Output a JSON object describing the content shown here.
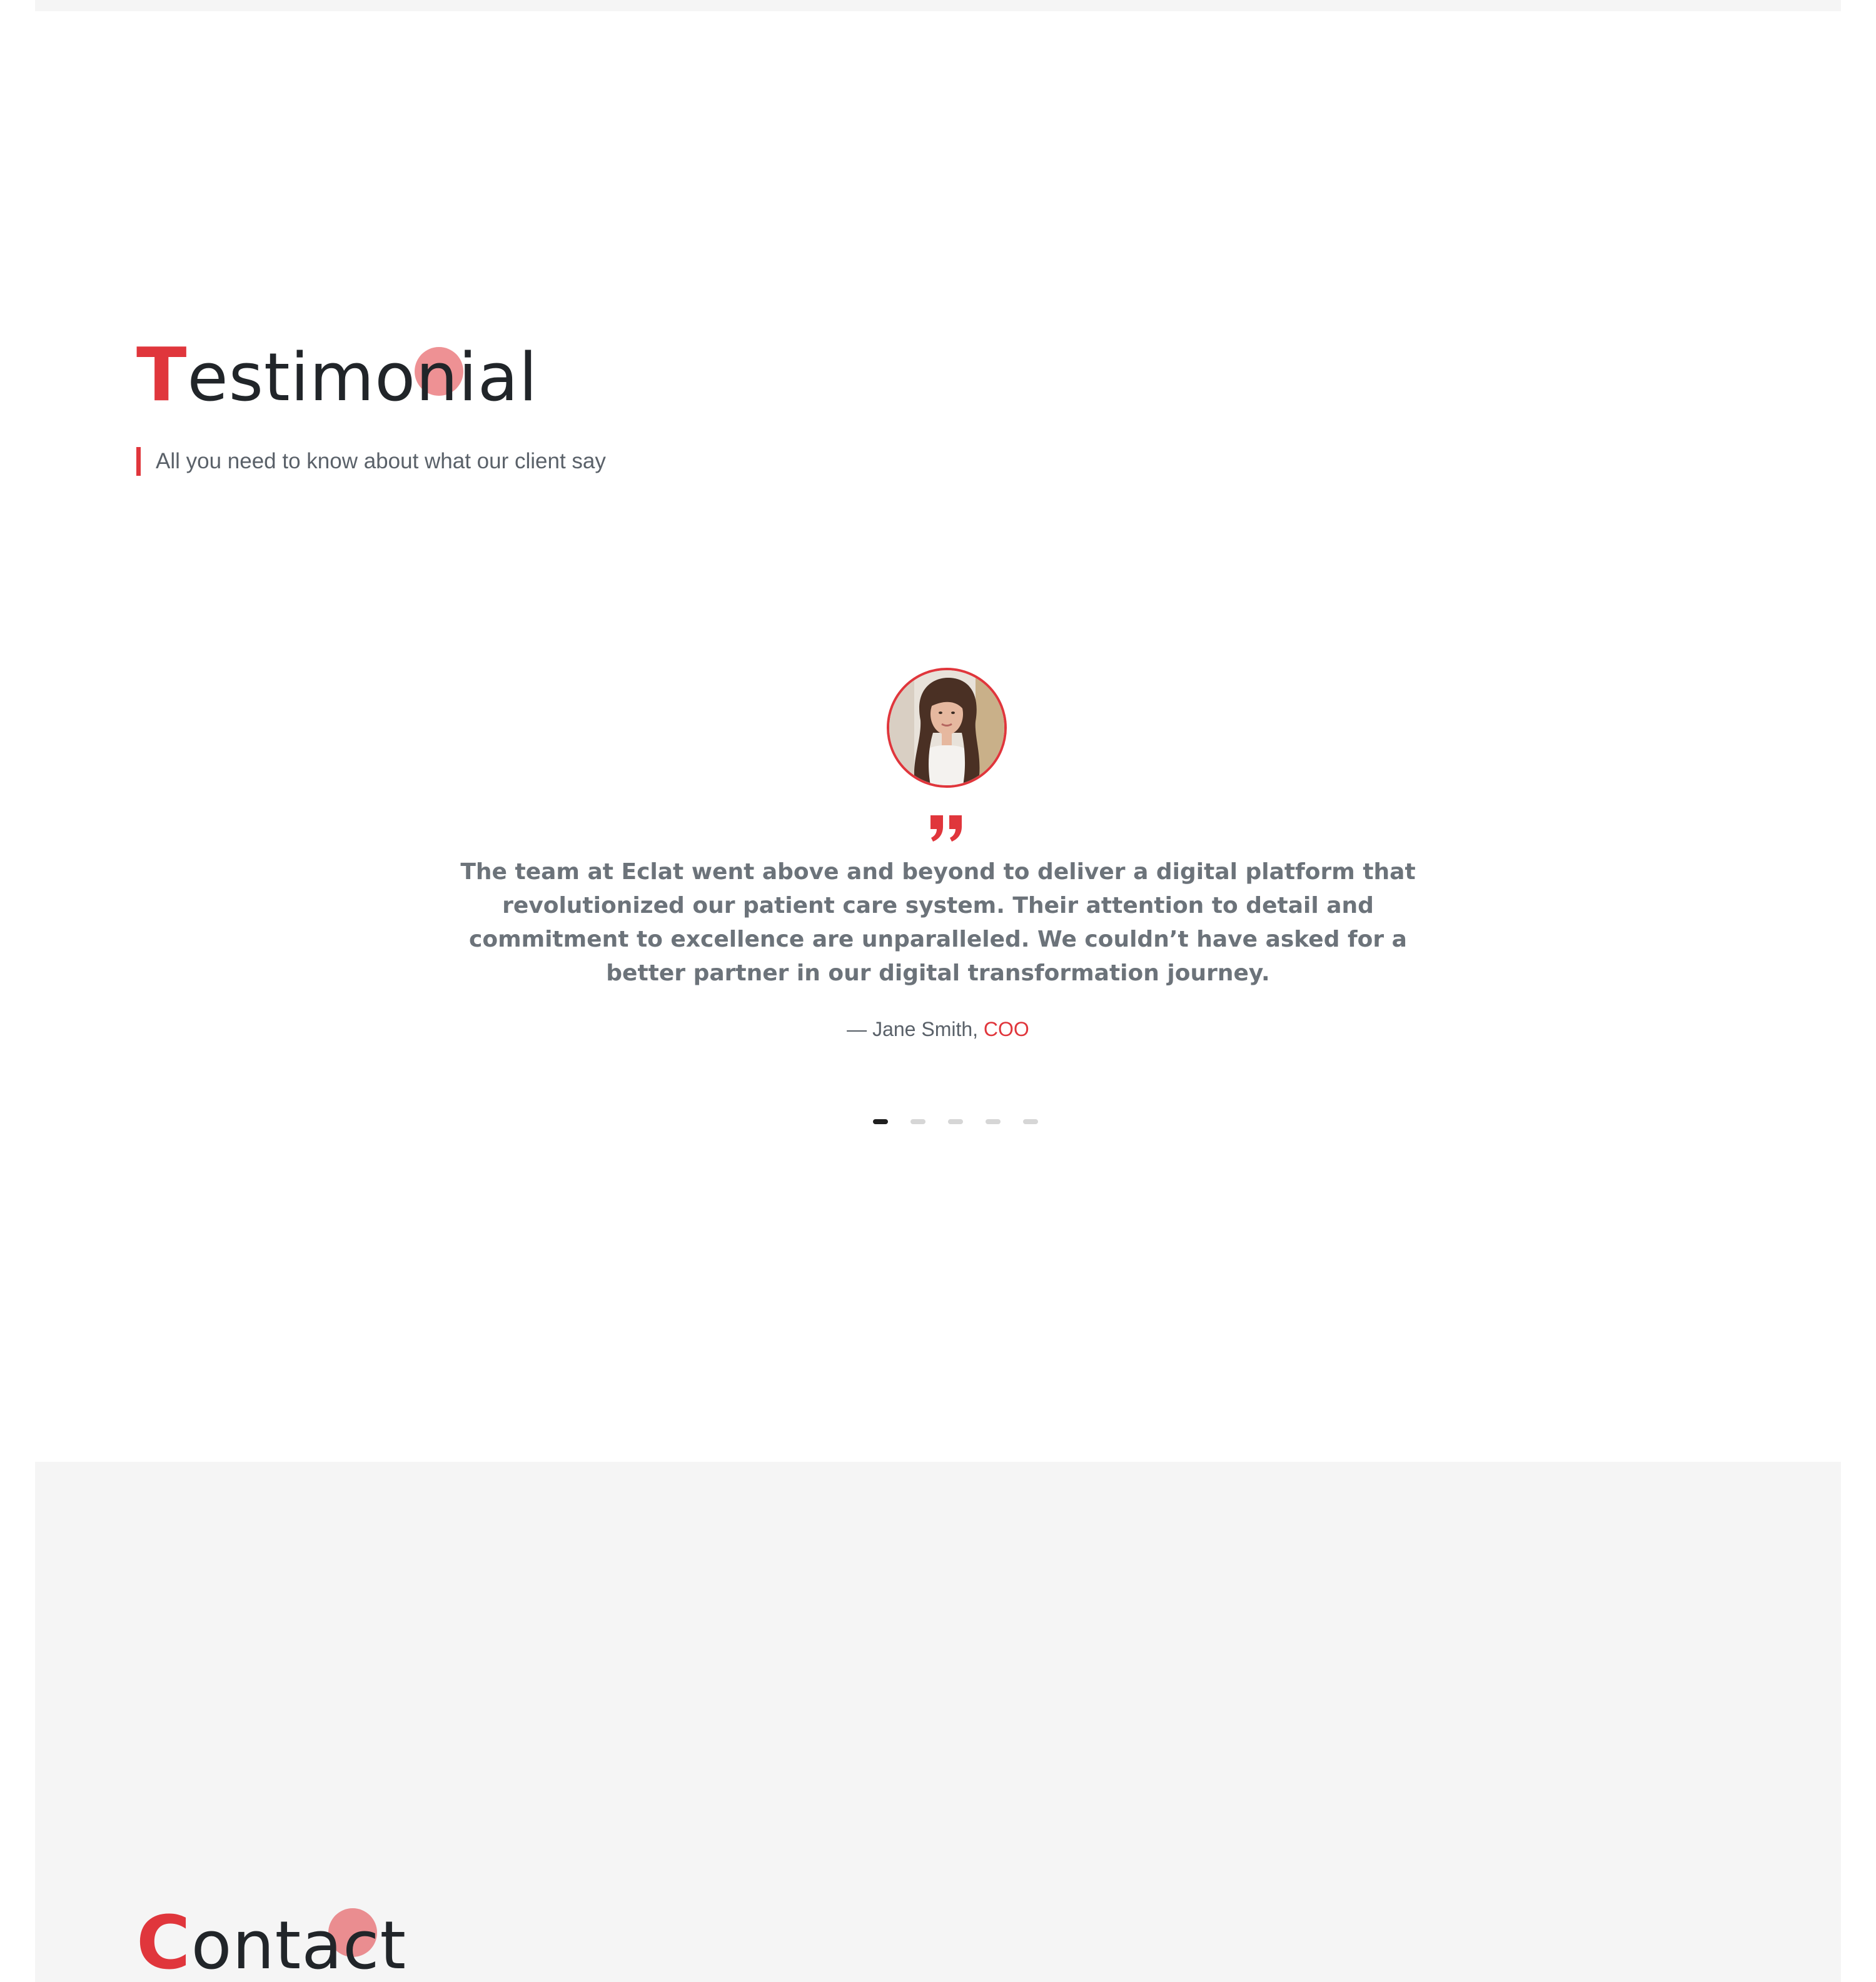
{
  "testimonial": {
    "title_first": "T",
    "title_rest": "estimonial",
    "subtitle": "All you need to know about what our client say",
    "slide": {
      "quote": "The team at Eclat went above and beyond to deliver a digital platform that revolutionized our patient care system. Their attention to detail and commitment to excellence are unparalleled. We couldn’t have asked for a better partner in our digital transformation journey.",
      "author": "— Jane Smith, ",
      "role": "COO"
    },
    "pagination": {
      "total": 5,
      "active_index": 0
    }
  },
  "contact": {
    "title_first": "C",
    "title_rest": "ontact"
  },
  "icons": {
    "quote": "quote-icon",
    "avatar": "client-photo"
  },
  "colors": {
    "accent": "#e0363c",
    "heading": "#212529",
    "body_text": "#6c737a",
    "section_alt_bg": "#f5f5f5",
    "dot_inactive": "#d6d6d6",
    "dot_active": "#1f1f1f"
  }
}
